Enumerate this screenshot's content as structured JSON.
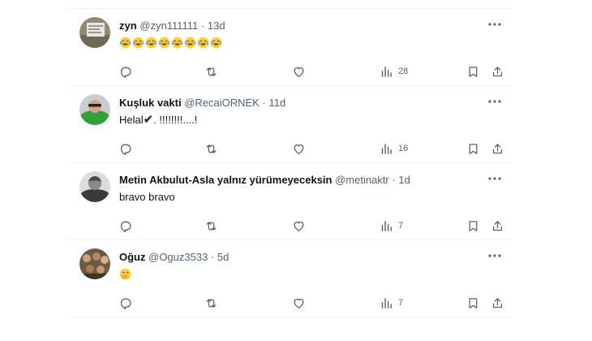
{
  "colors": {
    "text": "#0f1419",
    "secondary": "#536471",
    "separator": "#eff3f4",
    "background": "#ffffff"
  },
  "icons": {
    "more": "more-dots-icon",
    "reply": "reply-icon",
    "retweet": "retweet-icon",
    "like": "heart-icon",
    "views": "analytics-icon",
    "bookmark": "bookmark-icon",
    "share": "share-icon"
  },
  "tweets": [
    {
      "name": "zyn",
      "handle": "@zyn111111",
      "dot": "·",
      "time": "13d",
      "text": "",
      "emoji": [
        "face-with-tears-of-joy",
        "face-with-tears-of-joy",
        "face-with-tears-of-joy",
        "face-with-tears-of-joy",
        "face-with-tears-of-joy",
        "face-with-tears-of-joy",
        "face-with-tears-of-joy",
        "face-with-tears-of-joy"
      ],
      "views": "28"
    },
    {
      "name": "Kuşluk vakti",
      "handle": "@RecaiORNEK",
      "dot": "·",
      "time": "11d",
      "text_before": "Helal",
      "text_mark": "✔",
      "text_after": ". !!!!!!!!....!",
      "views": "16"
    },
    {
      "name": "Metin Akbulut-Asla yalnız yürümeyeceksin",
      "handle": "@metinaktr",
      "dot": "·",
      "time": "1d",
      "text": "bravo bravo",
      "views": "7"
    },
    {
      "name": "Oğuz",
      "handle": "@Oguz3533",
      "dot": "·",
      "time": "5d",
      "text": "",
      "emoji": [
        "face-with-hand-over-mouth"
      ],
      "views": "7"
    }
  ]
}
